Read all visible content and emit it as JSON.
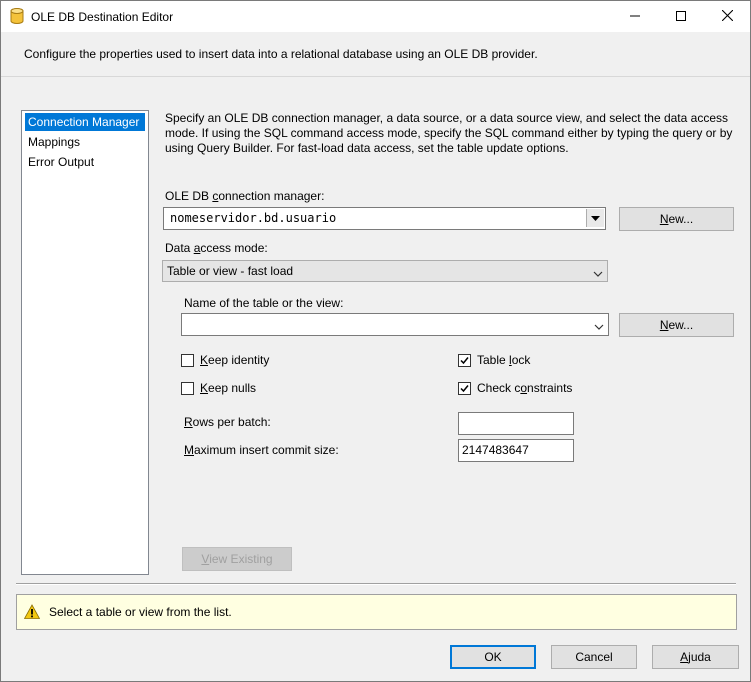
{
  "window": {
    "title": "OLE DB Destination Editor",
    "minimize_icon": "minimize-icon",
    "maximize_icon": "maximize-icon",
    "close_icon": "close-icon",
    "app_icon": "database-icon"
  },
  "header": {
    "description": "Configure the properties used to insert data into a relational database using an OLE DB provider."
  },
  "nav": {
    "items": [
      {
        "label": "Connection Manager",
        "selected": true
      },
      {
        "label": "Mappings",
        "selected": false
      },
      {
        "label": "Error Output",
        "selected": false
      }
    ]
  },
  "panel": {
    "description": "Specify an OLE DB connection manager, a data source, or a data source view, and select the data access mode. If using the SQL command access mode, specify the SQL command either by typing the query or by using Query Builder. For fast-load data access, set the table update options.",
    "connection_label_pre": "OLE DB ",
    "connection_label_key": "c",
    "connection_label_post": "onnection manager:",
    "connection_value": "nomeservidor.bd.usuario",
    "new_button_1_key": "N",
    "new_button_1_rest": "ew...",
    "access_label_pre": "Data ",
    "access_label_key": "a",
    "access_label_post": "ccess mode:",
    "access_value": "Table or view - fast load",
    "table_label": "Name of the table or the view:",
    "table_value": "",
    "new_button_2_key": "N",
    "new_button_2_rest": "ew...",
    "keep_identity_key": "K",
    "keep_identity_rest": "eep identity",
    "keep_identity_checked": false,
    "keep_nulls_key": "K",
    "keep_nulls_rest": "eep nulls",
    "keep_nulls_checked": false,
    "table_lock_pre": "Table ",
    "table_lock_key": "l",
    "table_lock_post": "ock",
    "table_lock_checked": true,
    "check_constraints_pre": "Check c",
    "check_constraints_key": "o",
    "check_constraints_post": "nstraints",
    "check_constraints_checked": true,
    "rows_label_key": "R",
    "rows_label_rest": "ows per batch:",
    "rows_value": "",
    "max_label_key": "M",
    "max_label_rest": "aximum insert commit size:",
    "max_value": "2147483647",
    "view_existing_key": "V",
    "view_existing_rest": "iew Existing"
  },
  "message": {
    "icon": "warning-icon",
    "text": "Select a table or view from the list."
  },
  "footer": {
    "ok_label": "OK",
    "cancel_label": "Cancel",
    "help_key": "A",
    "help_rest": "juda"
  },
  "colors": {
    "selection": "#0078d7",
    "message_bg": "#ffffe1",
    "warning": "#f2c811"
  }
}
